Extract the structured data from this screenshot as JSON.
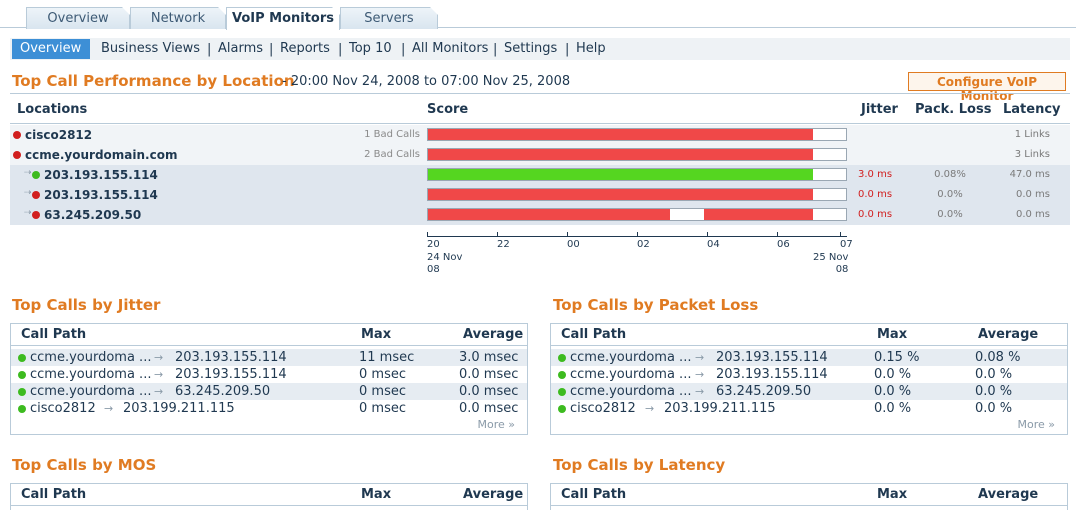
{
  "tabs": [
    {
      "label": "Overview"
    },
    {
      "label": "Network"
    },
    {
      "label": "VoIP Monitors"
    },
    {
      "label": "Servers"
    }
  ],
  "subnav": [
    "Overview",
    "Business Views",
    "Alarms",
    "Reports",
    "Top 10",
    "All Monitors",
    "Settings",
    "Help"
  ],
  "header": {
    "title": "Top Call Performance by Location",
    "date_range": "- 20:00 Nov 24, 2008 to 07:00 Nov 25, 2008",
    "config_button": "Configure VoIP Monitor"
  },
  "locations": {
    "columns": {
      "locations": "Locations",
      "score": "Score",
      "jitter": "Jitter",
      "pack_loss": "Pack. Loss",
      "latency": "Latency"
    },
    "rows": [
      {
        "name": "cisco2812",
        "status": "red",
        "bad": "1 Bad Calls",
        "jitter": "",
        "pack_loss": "",
        "latency": "1 Links",
        "child": false,
        "score_fraction": 0.92,
        "score_color": "#f04848"
      },
      {
        "name": "ccme.yourdomain.com",
        "status": "red",
        "bad": "2 Bad Calls",
        "jitter": "",
        "pack_loss": "",
        "latency": "3 Links",
        "child": false,
        "score_fraction": 0.92,
        "score_color": "#f04848"
      },
      {
        "name": "203.193.155.114",
        "status": "green",
        "bad": "",
        "jitter": "3.0 ms",
        "pack_loss": "0.08%",
        "latency": "47.0 ms",
        "child": true,
        "score_fraction": 0.92,
        "score_color": "#55d620"
      },
      {
        "name": "203.193.155.114",
        "status": "red",
        "bad": "",
        "jitter": "0.0 ms",
        "pack_loss": "0.0%",
        "latency": "0.0 ms",
        "child": true,
        "score_fraction": 0.92,
        "score_color": "#f04848"
      },
      {
        "name": "63.245.209.50",
        "status": "red",
        "bad": "",
        "jitter": "0.0 ms",
        "pack_loss": "0.0%",
        "latency": "0.0 ms",
        "child": true,
        "score_fraction": 0.92,
        "score_color": "#f04848",
        "gap": [
          0.58,
          0.66
        ]
      }
    ]
  },
  "axis": {
    "ticks": [
      "20",
      "22",
      "00",
      "02",
      "04",
      "06",
      "07"
    ],
    "start_date": "24 Nov",
    "start_year": "08",
    "end_date": "25 Nov",
    "end_year": "08"
  },
  "jitter_panel": {
    "title": "Top Calls by Jitter",
    "columns": {
      "path": "Call Path",
      "max": "Max",
      "avg": "Average"
    },
    "rows": [
      {
        "from": "ccme.yourdoma ...",
        "to": "203.193.155.114",
        "max": "11 msec",
        "avg": "3.0 msec"
      },
      {
        "from": "ccme.yourdoma ...",
        "to": "203.193.155.114",
        "max": "0 msec",
        "avg": "0.0 msec"
      },
      {
        "from": "ccme.yourdoma ...",
        "to": "63.245.209.50",
        "max": "0 msec",
        "avg": "0.0 msec"
      },
      {
        "from": "cisco2812",
        "to": "203.199.211.115",
        "max": "0 msec",
        "avg": "0.0 msec"
      }
    ],
    "more": "More »"
  },
  "packet_panel": {
    "title": "Top Calls by Packet Loss",
    "columns": {
      "path": "Call Path",
      "max": "Max",
      "avg": "Average"
    },
    "rows": [
      {
        "from": "ccme.yourdoma ...",
        "to": "203.193.155.114",
        "max": "0.15 %",
        "avg": "0.08 %"
      },
      {
        "from": "ccme.yourdoma ...",
        "to": "203.193.155.114",
        "max": "0.0 %",
        "avg": "0.0 %"
      },
      {
        "from": "ccme.yourdoma ...",
        "to": "63.245.209.50",
        "max": "0.0 %",
        "avg": "0.0 %"
      },
      {
        "from": "cisco2812",
        "to": "203.199.211.115",
        "max": "0.0 %",
        "avg": "0.0 %"
      }
    ],
    "more": "More »"
  },
  "mos_panel": {
    "title": "Top Calls by MOS",
    "columns": {
      "path": "Call Path",
      "max": "Max",
      "avg": "Average"
    }
  },
  "latency_panel": {
    "title": "Top Calls by Latency",
    "columns": {
      "path": "Call Path",
      "max": "Max",
      "avg": "Average"
    }
  },
  "colors": {
    "accent": "#e07b22",
    "navy": "#1f3850",
    "red": "#d11f1f",
    "green": "#3dbb1f"
  }
}
